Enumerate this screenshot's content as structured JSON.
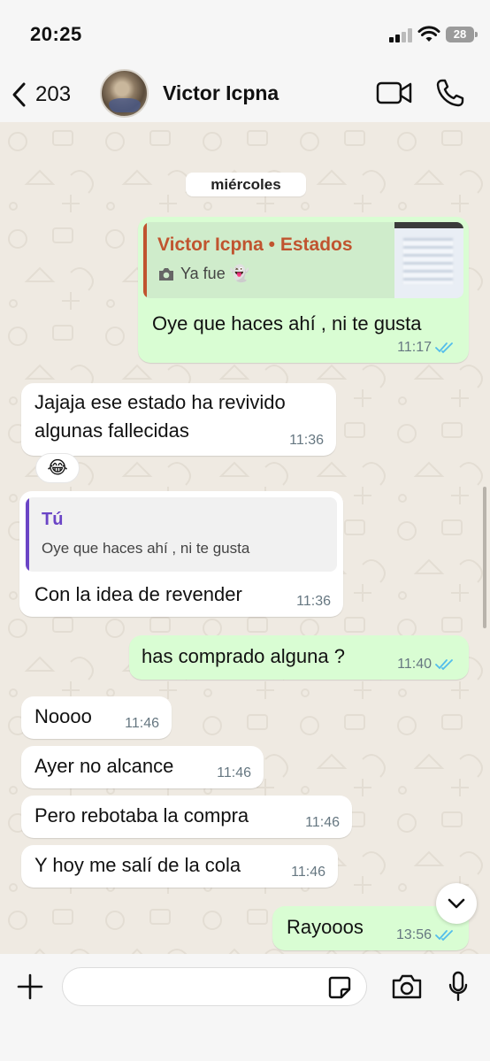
{
  "status_bar": {
    "time": "20:25",
    "battery": "28"
  },
  "header": {
    "back_count": "203",
    "contact_name": "Victor Icpna"
  },
  "chat": {
    "date_separator": "miércoles",
    "messages": [
      {
        "id": "m1",
        "direction": "out",
        "quote_title": "Victor Icpna • Estados",
        "quote_subtitle": "Ya fue 👻",
        "text": "Oye que haces ahí , ni te gusta",
        "time": "11:17",
        "status": "read"
      },
      {
        "id": "m2",
        "direction": "in",
        "text_line1": "Jajaja ese estado ha revivido",
        "text_line2": "algunas fallecidas",
        "time": "11:36",
        "reaction": "😂"
      },
      {
        "id": "m3",
        "direction": "in",
        "quote_title": "Tú",
        "quote_text": "Oye que haces ahí , ni te gusta",
        "text": "Con la idea de revender",
        "time": "11:36"
      },
      {
        "id": "m4",
        "direction": "out",
        "text": "has comprado alguna ?",
        "time": "11:40",
        "status": "read"
      },
      {
        "id": "m5",
        "direction": "in",
        "text": "Noooo",
        "time": "11:46"
      },
      {
        "id": "m6",
        "direction": "in",
        "text": "Ayer no alcance",
        "time": "11:46"
      },
      {
        "id": "m7",
        "direction": "in",
        "text": "Pero rebotaba la compra",
        "time": "11:46"
      },
      {
        "id": "m8",
        "direction": "in",
        "text": "Y hoy me salí de la cola",
        "time": "11:46"
      },
      {
        "id": "m9",
        "direction": "out",
        "text": "Rayooos",
        "time": "13:56",
        "status": "read"
      }
    ]
  },
  "input": {
    "placeholder": ""
  },
  "icons": {
    "back": "chevron-left-icon",
    "video": "video-camera-icon",
    "call": "phone-icon",
    "plus": "plus-icon",
    "sticker": "sticker-icon",
    "camera": "camera-icon",
    "mic": "microphone-icon",
    "scroll": "chevron-down-icon"
  },
  "colors": {
    "outgoing_bubble": "#d9fdd3",
    "incoming_bubble": "#ffffff",
    "chat_background": "#efeae2",
    "read_ticks": "#53bdeb",
    "status_quote_accent": "#c0542f",
    "reply_quote_accent": "#6b45c6"
  }
}
